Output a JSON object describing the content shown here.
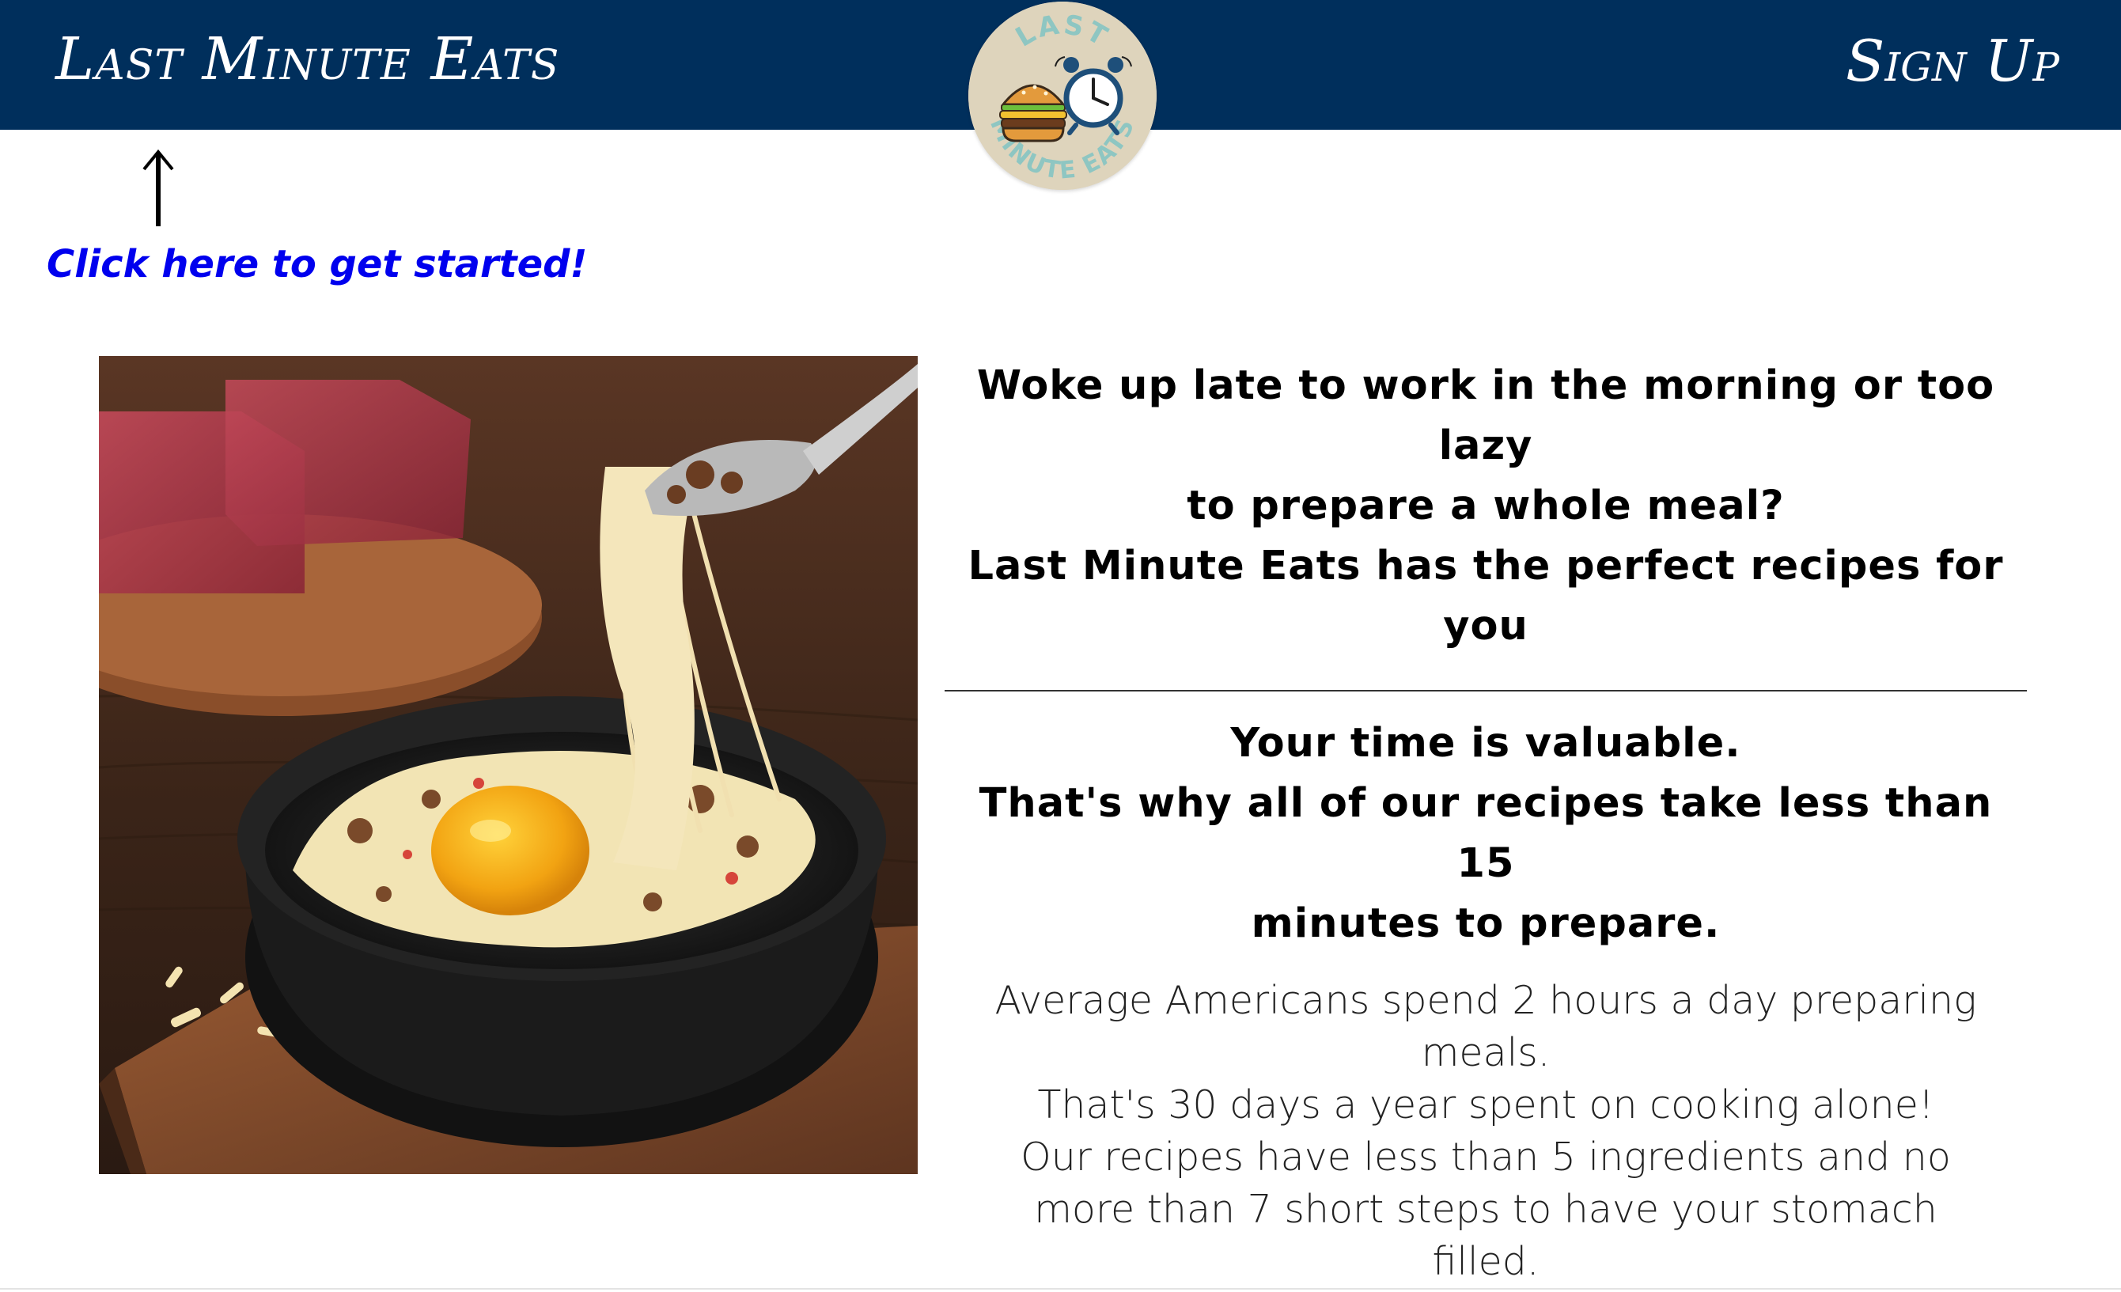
{
  "header": {
    "brand": "Last Minute Eats",
    "signup_label": "Sign Up",
    "background_color": "#002f5c"
  },
  "logo": {
    "text_top": "LAST",
    "text_bottom": "MINUTE EATS",
    "icons": [
      "burger-icon",
      "alarm-clock-icon"
    ]
  },
  "cta": {
    "arrow_icon": "up-arrow-icon",
    "label": "Click here to get started!",
    "color": "#0000ee"
  },
  "hero": {
    "description_icon": "cheesy-egg-bowl-image"
  },
  "intro": {
    "lines": [
      "Woke up late to work in the morning or too lazy",
      "to prepare a whole meal?",
      "Last Minute Eats has the perfect recipes for you"
    ]
  },
  "value": {
    "lines": [
      "Your time is valuable.",
      "That's why all of our recipes take less than 15",
      "minutes to prepare."
    ]
  },
  "facts": {
    "lines": [
      "Average Americans spend 2 hours a day preparing",
      "meals.",
      "That's 30 days a year spent on cooking alone!",
      "Our recipes have less than 5 ingredients and no",
      "more than 7 short steps to have your stomach",
      "filled."
    ]
  }
}
